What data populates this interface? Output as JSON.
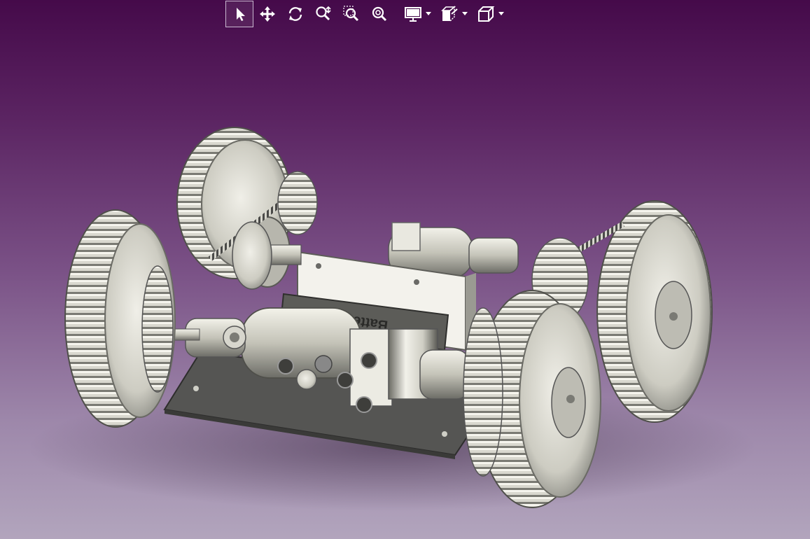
{
  "toolbar": {
    "tools": [
      {
        "name": "select-arrow-icon",
        "active": true
      },
      {
        "name": "pan-icon",
        "active": false
      },
      {
        "name": "rotate-icon",
        "active": false
      },
      {
        "name": "zoom-dynamic-icon",
        "active": false
      },
      {
        "name": "zoom-window-icon",
        "active": false
      },
      {
        "name": "zoom-fit-icon",
        "active": false
      },
      {
        "name": "display-mode-icon",
        "active": false,
        "dropdown": true
      },
      {
        "name": "section-view-icon",
        "active": false,
        "dropdown": true
      },
      {
        "name": "view-cube-icon",
        "active": false,
        "dropdown": true
      }
    ]
  },
  "viewport": {
    "model_label": "Battery",
    "background_top": "#450a4a",
    "background_bottom": "#b2a5bd"
  },
  "colors": {
    "icon": "#ffffff",
    "metal_light": "#f1f0e8",
    "metal_mid": "#b8b8ad",
    "metal_dark": "#5d5d58",
    "plate": "#555555"
  }
}
